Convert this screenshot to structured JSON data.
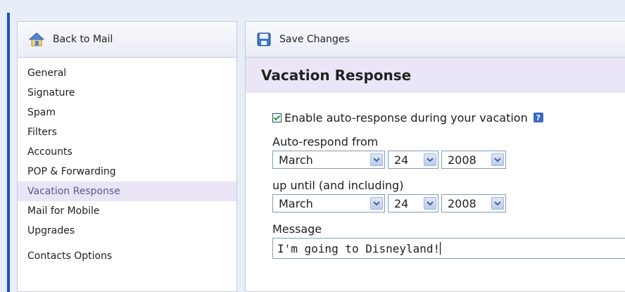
{
  "sidebar": {
    "back_label": "Back to Mail",
    "items": [
      {
        "label": "General"
      },
      {
        "label": "Signature"
      },
      {
        "label": "Spam"
      },
      {
        "label": "Filters"
      },
      {
        "label": "Accounts"
      },
      {
        "label": "POP & Forwarding"
      },
      {
        "label": "Vacation Response",
        "active": true
      },
      {
        "label": "Mail for Mobile"
      },
      {
        "label": "Upgrades"
      },
      {
        "label": "Contacts Options"
      }
    ]
  },
  "toolbar": {
    "save_label": "Save Changes"
  },
  "main": {
    "title": "Vacation Response",
    "enable_label": "Enable auto-response during your vacation",
    "enable_checked": true,
    "help_glyph": "?",
    "from_label": "Auto-respond from",
    "from": {
      "month": "March",
      "day": "24",
      "year": "2008"
    },
    "until_label": "up until (and including)",
    "until": {
      "month": "March",
      "day": "24",
      "year": "2008"
    },
    "message_label": "Message",
    "message_value": "I'm going to Disneyland!"
  },
  "colors": {
    "accent": "#1f4fbf",
    "title_band": "#ebe6f7",
    "active_item": "#e9e4f6",
    "page_bg": "#e8eef8"
  },
  "icons": {
    "back": "home-icon",
    "save": "save-icon",
    "help": "help-icon"
  }
}
